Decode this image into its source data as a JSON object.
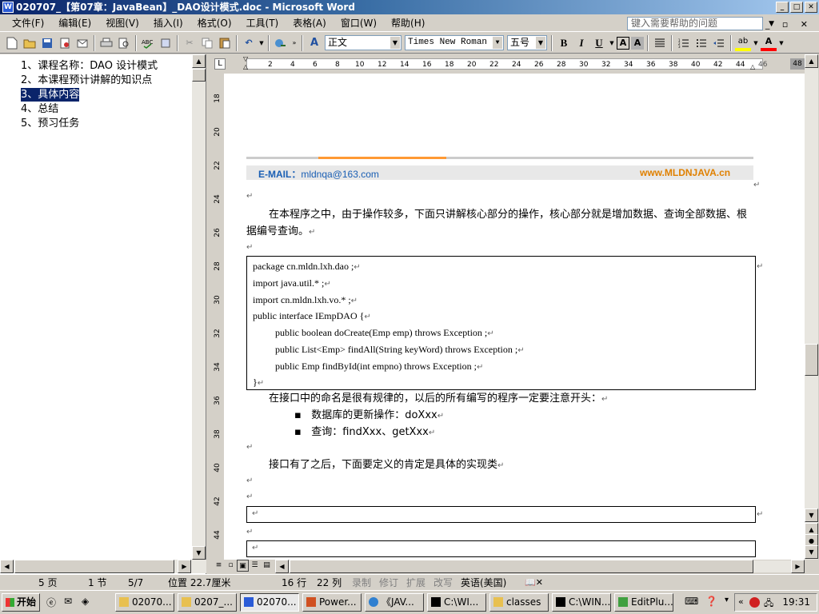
{
  "window": {
    "title": "020707_【第07章：JavaBean】_DAO设计模式.doc - Microsoft Word"
  },
  "menu": {
    "items": [
      "文件(F)",
      "编辑(E)",
      "视图(V)",
      "插入(I)",
      "格式(O)",
      "工具(T)",
      "表格(A)",
      "窗口(W)",
      "帮助(H)"
    ],
    "help_placeholder": "键入需要帮助的问题"
  },
  "toolbar": {
    "style": "正文",
    "font": "Times New Roman",
    "size": "五号",
    "bold": "B",
    "italic": "I",
    "underline": "U",
    "fontcolor": "A",
    "highlight": "ab"
  },
  "nav": {
    "items": [
      "1、课程名称：DAO 设计模式",
      "2、本课程预计讲解的知识点",
      "3、具体内容",
      "4、总结",
      "5、预习任务"
    ],
    "selected_index": 2
  },
  "ruler": {
    "top": [
      "2",
      "4",
      "6",
      "8",
      "10",
      "12",
      "14",
      "16",
      "18",
      "20",
      "22",
      "24",
      "26",
      "28",
      "30",
      "32",
      "34",
      "36",
      "38",
      "40",
      "42",
      "44",
      "46",
      "48"
    ],
    "left": [
      "18",
      "20",
      "22",
      "24",
      "26",
      "28",
      "30",
      "32",
      "34",
      "36",
      "38",
      "40",
      "42",
      "44"
    ]
  },
  "doc": {
    "header_email_label": "E-MAIL：",
    "header_email": "mldnqa@163.com",
    "header_site": "www.MLDNJAVA.cn",
    "para_mark": "↵",
    "para1": "在本程序之中，由于操作较多，下面只讲解核心部分的操作，核心部分就是增加数据、查询全部数据、根据编号查询。",
    "code": [
      "package cn.mldn.lxh.dao ;",
      "import java.util.* ;",
      "import cn.mldn.lxh.vo.* ;",
      "public interface IEmpDAO {",
      "public boolean doCreate(Emp emp) throws Exception ;",
      "public List<Emp> findAll(String keyWord) throws Exception ;",
      "public Emp findById(int empno) throws Exception ;",
      "}"
    ],
    "para2": "在接口中的命名是很有规律的，以后的所有编写的程序一定要注意开头：",
    "bullet_char": "▪",
    "bullet1": "数据库的更新操作：doXxx",
    "bullet2": "查询：findXxx、getXxx",
    "para3": "接口有了之后，下面要定义的肯定是具体的实现类"
  },
  "status": {
    "page": "5 页",
    "section": "1 节",
    "pages": "5/7",
    "position": "位置 22.7厘米",
    "line": "16 行",
    "col": "22 列",
    "rec": "录制",
    "trk": "修订",
    "ext": "扩展",
    "ovr": "改写",
    "lang": "英语(美国)"
  },
  "taskbar": {
    "start": "开始",
    "tasks": [
      "02070...",
      "0207_...",
      "02070...",
      "Power...",
      "《JAV...",
      "C:\\WI...",
      "classes",
      "C:\\WIN...",
      "EditPlu..."
    ],
    "active_index": 2,
    "clock": "19:31"
  }
}
